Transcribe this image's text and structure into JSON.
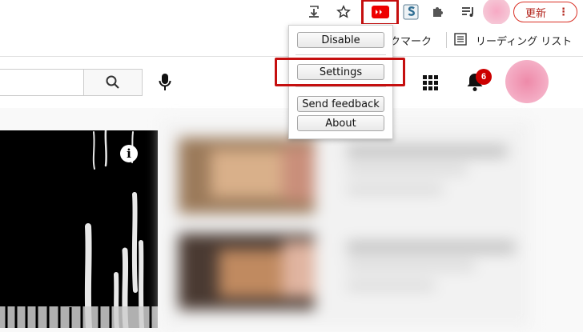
{
  "browser": {
    "update_label": "更新",
    "more_dots": "⋮",
    "icons": [
      "download-icon",
      "star-icon",
      "youtube-extension-icon",
      "s-extension-icon",
      "puzzle-icon",
      "reading-list-icon",
      "profile-avatar"
    ]
  },
  "bookmarks": {
    "partial_label": "クマーク",
    "reading_list_label": "リーディング リスト"
  },
  "popup": {
    "disable": "Disable",
    "settings": "Settings",
    "send_feedback": "Send feedback",
    "about": "About"
  },
  "youtube": {
    "notification_count": "6",
    "info_glyph": "i"
  },
  "colors": {
    "highlight": "#c50f0f",
    "youtube_red": "#ff0000",
    "badge": "#cc0000"
  }
}
